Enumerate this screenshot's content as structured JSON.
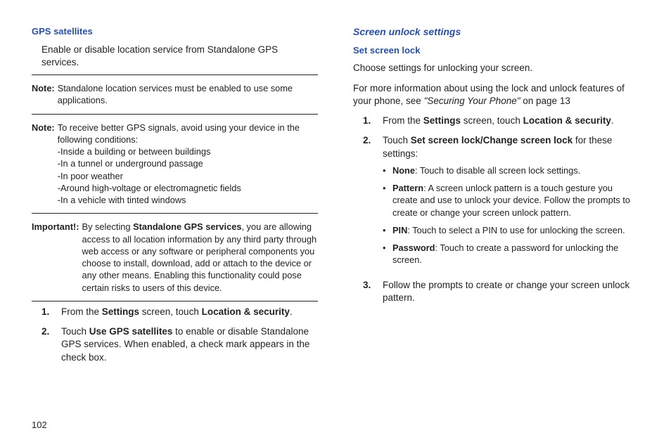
{
  "left": {
    "heading": "GPS satellites",
    "intro": "Enable or disable location service from Standalone GPS services.",
    "note1_label": "Note:",
    "note1_body": "Standalone location services must be enabled to use some applications.",
    "note2_label": "Note:",
    "note2_body_intro": "To receive better GPS signals, avoid using your device in the following conditions:",
    "note2_line1": "-Inside a building or between buildings",
    "note2_line2": "-In a tunnel or underground passage",
    "note2_line3": "-In poor weather",
    "note2_line4": "-Around high-voltage or electromagnetic fields",
    "note2_line5": "-In a vehicle with tinted windows",
    "important_label": "Important!:",
    "important_body_pre": "By selecting ",
    "important_bold": "Standalone GPS services",
    "important_body_post": ", you are allowing access to all location information by any third party through web access or any software or peripheral components you choose to install, download, add or attach to the device or any other means. Enabling this functionality could pose certain risks to users of this device.",
    "step1_num": "1.",
    "step1_pre": "From the ",
    "step1_b1": "Settings",
    "step1_mid": " screen, touch ",
    "step1_b2": "Location & security",
    "step1_post": ".",
    "step2_num": "2.",
    "step2_pre": "Touch ",
    "step2_b1": "Use GPS satellites",
    "step2_post": " to enable or disable Standalone GPS services. When enabled, a check mark appears in the check box."
  },
  "right": {
    "heading1": "Screen unlock settings",
    "heading2": "Set screen lock",
    "para1": "Choose settings for unlocking your screen.",
    "para2_pre": "For more information about using the lock and unlock features of your phone, see ",
    "para2_italic": "\"Securing Your Phone\"",
    "para2_post": " on page 13",
    "step1_num": "1.",
    "step1_pre": "From the ",
    "step1_b1": "Settings",
    "step1_mid": " screen, touch ",
    "step1_b2": "Location & security",
    "step1_post": ".",
    "step2_num": "2.",
    "step2_pre": "Touch ",
    "step2_b1": "Set screen lock/Change screen lock",
    "step2_post": " for these settings:",
    "bullet1_b": "None",
    "bullet1_post": ": Touch to disable all screen lock settings.",
    "bullet2_b": "Pattern",
    "bullet2_post": ": A screen unlock pattern is a touch gesture you create and use to unlock your device. Follow the prompts to create or change your screen unlock pattern.",
    "bullet3_b": "PIN",
    "bullet3_post": ": Touch to select a PIN to use for unlocking the screen.",
    "bullet4_b": "Password",
    "bullet4_post": ": Touch to create a password for unlocking the screen.",
    "step3_num": "3.",
    "step3_body": "Follow the prompts to create or change your screen unlock pattern."
  },
  "page_number": "102"
}
